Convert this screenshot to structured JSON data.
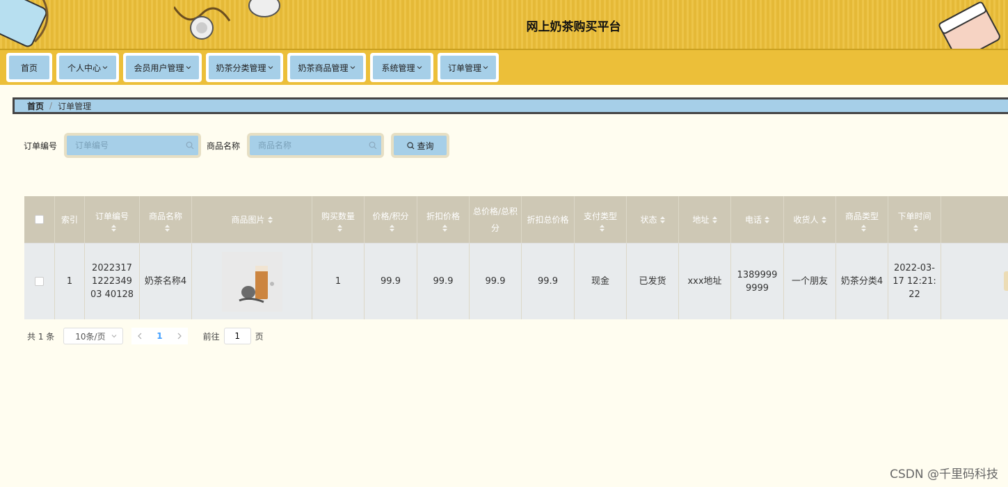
{
  "header": {
    "title": "网上奶茶购买平台"
  },
  "nav": {
    "items": [
      {
        "label": "首页",
        "dropdown": false
      },
      {
        "label": "个人中心",
        "dropdown": true
      },
      {
        "label": "会员用户管理",
        "dropdown": true
      },
      {
        "label": "奶茶分类管理",
        "dropdown": true
      },
      {
        "label": "奶茶商品管理",
        "dropdown": true
      },
      {
        "label": "系统管理",
        "dropdown": true
      },
      {
        "label": "订单管理",
        "dropdown": true
      }
    ]
  },
  "breadcrumb": {
    "home": "首页",
    "separator": "/",
    "current": "订单管理"
  },
  "search": {
    "order_label": "订单编号",
    "order_placeholder": "订单编号",
    "product_label": "商品名称",
    "product_placeholder": "商品名称",
    "button_label": "查询"
  },
  "table": {
    "headers": {
      "index": "索引",
      "order_no": "订单编号",
      "product_name": "商品名称",
      "product_image": "商品图片",
      "qty": "购买数量",
      "price": "价格/积分",
      "discount_price": "折扣价格",
      "total": "总价格/总积分",
      "discount_total": "折扣总价格",
      "pay_type": "支付类型",
      "status": "状态",
      "address": "地址",
      "phone": "电话",
      "receiver": "收货人",
      "category": "商品类型",
      "order_time": "下单时间"
    },
    "rows": [
      {
        "index": "1",
        "order_no": "2022317122234903 40128",
        "product_name": "奶茶名称4",
        "qty": "1",
        "price": "99.9",
        "discount_price": "99.9",
        "total": "99.9",
        "discount_total": "99.9",
        "pay_type": "现金",
        "status": "已发货",
        "address": "xxx地址",
        "phone": "13899999999",
        "receiver": "一个朋友",
        "category": "奶茶分类4",
        "order_time": "2022-03-17 12:21:22"
      }
    ]
  },
  "pagination": {
    "total_text": "共 1 条",
    "page_size": "10条/页",
    "current_page": "1",
    "goto_label": "前往",
    "goto_value": "1",
    "page_suffix": "页"
  },
  "watermark": "CSDN @千里码科技",
  "colors": {
    "header_bg": "#ecbf39",
    "nav_inner": "#a6cfe8",
    "table_head": "#cec8b5",
    "row_bg": "#e8ebed",
    "page_bg": "#fffdf0"
  }
}
